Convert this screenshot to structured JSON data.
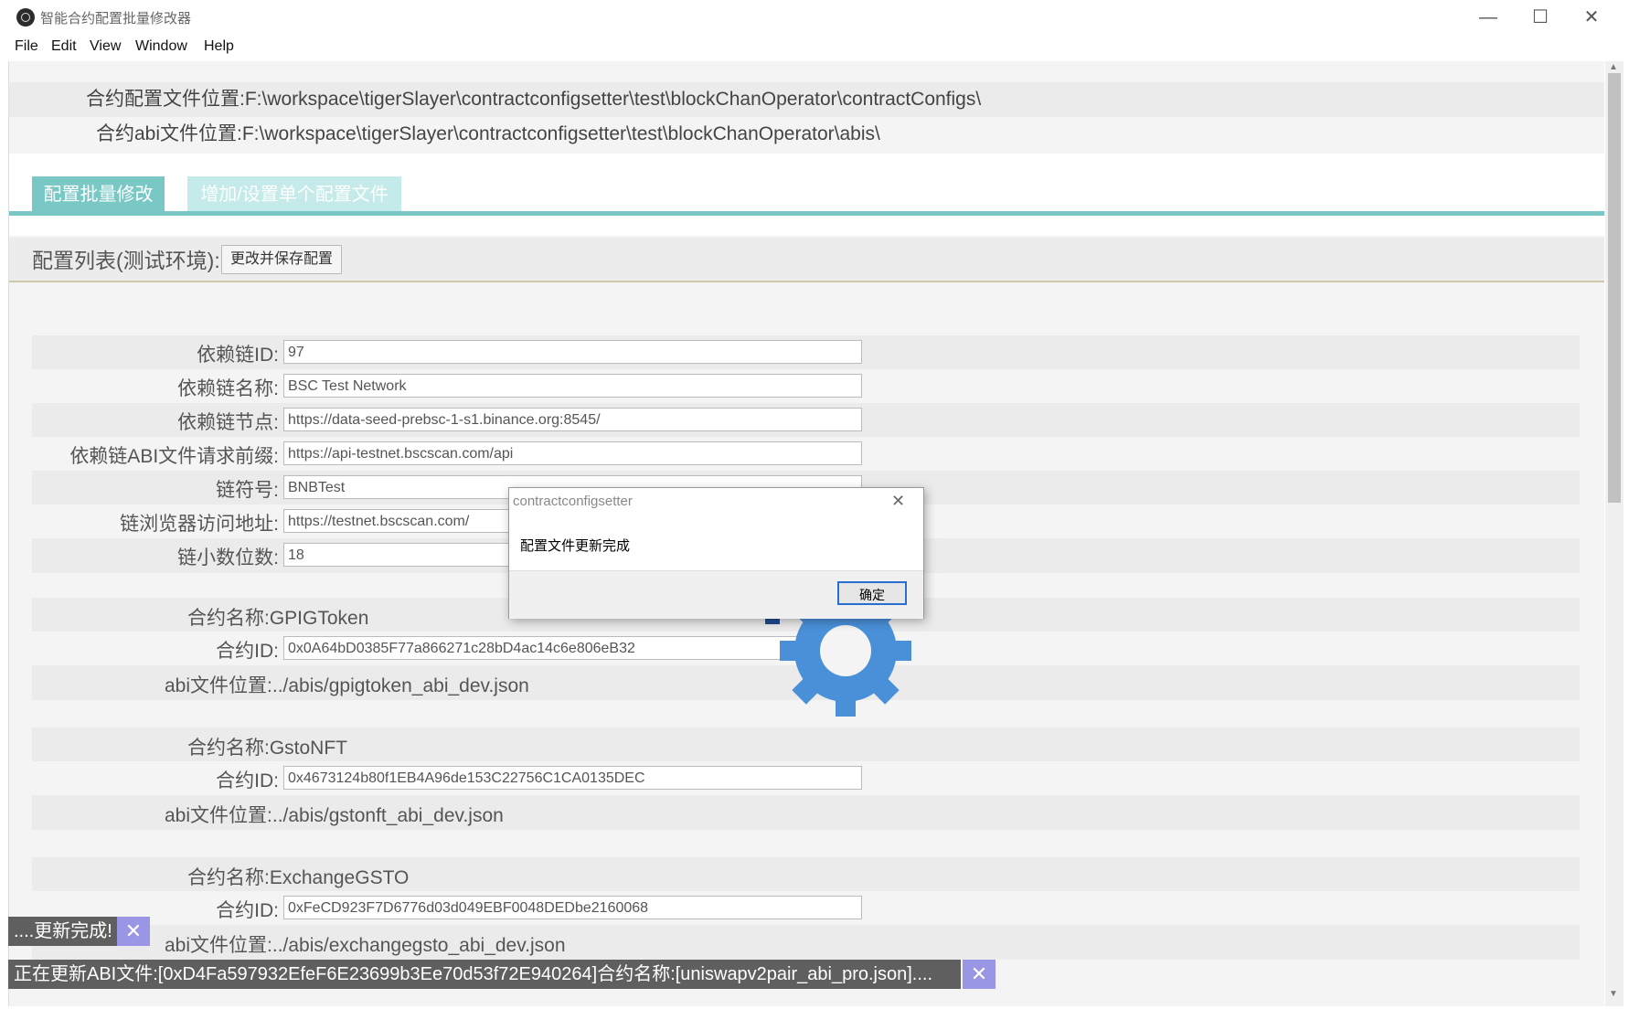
{
  "window": {
    "title": "智能合约配置批量修改器"
  },
  "menu": [
    "File",
    "Edit",
    "View",
    "Window",
    "Help"
  ],
  "paths": {
    "config": "合约配置文件位置:F:\\workspace\\tigerSlayer\\contractconfigsetter\\test\\blockChanOperator\\contractConfigs\\",
    "abi": "合约abi文件位置:F:\\workspace\\tigerSlayer\\contractconfigsetter\\test\\blockChanOperator\\abis\\"
  },
  "tabs": {
    "active": "配置批量修改",
    "inactive": "增加/设置单个配置文件"
  },
  "list": {
    "title": "配置列表(测试环境):",
    "save_label": "更改并保存配置"
  },
  "chain_fields": [
    {
      "label": "依赖链ID:",
      "value": "97"
    },
    {
      "label": "依赖链名称:",
      "value": "BSC Test Network"
    },
    {
      "label": "依赖链节点:",
      "value": "https://data-seed-prebsc-1-s1.binance.org:8545/"
    },
    {
      "label": "依赖链ABI文件请求前缀:",
      "value": "https://api-testnet.bscscan.com/api"
    },
    {
      "label": "链符号:",
      "value": "BNBTest"
    },
    {
      "label": "链浏览器访问地址:",
      "value": "https://testnet.bscscan.com/"
    },
    {
      "label": "链小数位数:",
      "value": "18"
    }
  ],
  "contracts": [
    {
      "name": "合约名称:GPIGToken",
      "id_label": "合约ID:",
      "id": "0x0A64bD0385F77a866271c28bD4ac14c6e806eB32",
      "abi": "abi文件位置:../abis/gpigtoken_abi_dev.json"
    },
    {
      "name": "合约名称:GstoNFT",
      "id_label": "合约ID:",
      "id": "0x4673124b80f1EB4A96de153C22756C1CA0135DEC",
      "abi": "abi文件位置:../abis/gstonft_abi_dev.json"
    },
    {
      "name": "合约名称:ExchangeGSTO",
      "id_label": "合约ID:",
      "id": "0xFeCD923F7D6776d03d049EBF0048DEDbe2160068",
      "abi": "abi文件位置:../abis/exchangegsto_abi_dev.json"
    }
  ],
  "dialog": {
    "title": "contractconfigsetter",
    "message": "配置文件更新完成",
    "ok": "确定",
    "close": "✕"
  },
  "toasts": {
    "done": "....更新完成!",
    "progress": "正在更新ABI文件:[0xD4Fa597932EfeF6E23699b3Ee70d53f72E940264]合约名称:[uniswapv2pair_abi_pro.json]....",
    "close": "✕"
  },
  "controls": {
    "minimize": "—",
    "maximize": "☐",
    "close": "✕",
    "scroll_up": "▲",
    "scroll_down": "▼"
  },
  "colors": {
    "tab_active": "#79c8c6",
    "tab_inactive": "#c4ebea",
    "gear_dark": "#1f4c8f",
    "gear_light": "#4a90d9",
    "toast_close": "#9a96e6"
  }
}
